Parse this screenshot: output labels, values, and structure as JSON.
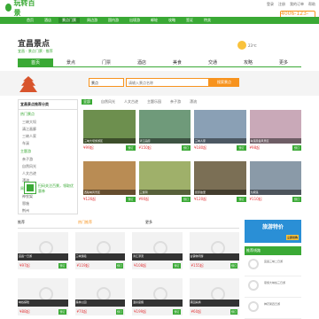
{
  "header": {
    "logo_text": "玩转百景",
    "top_links": [
      "登录",
      "注册",
      "我的订单",
      "帮助"
    ],
    "hotline": "4006-123-100"
  },
  "nav": {
    "items": [
      "首页",
      "酒店",
      "景点门票",
      "周边游",
      "国内游",
      "出境游",
      "邮轮",
      "攻略",
      "签证",
      "特卖"
    ],
    "active_index": 2
  },
  "page": {
    "title": "宜昌景点",
    "subtitle": "宜昌 · 景点门票 · 推荐",
    "weather": "23℃"
  },
  "tabs": {
    "items": [
      "首页",
      "景点",
      "门票",
      "酒店",
      "美食",
      "交通",
      "攻略",
      "更多"
    ],
    "active_index": 0
  },
  "search": {
    "select_value": "景点",
    "placeholder": "请输入景点名称",
    "button": "搜索景点"
  },
  "sidebar": {
    "title": "宜昌景点推荐分类",
    "sections": [
      {
        "name": "热门景点",
        "items": [
          "三峡大坝",
          "清江画廊",
          "三峡人家",
          "车溪"
        ]
      },
      {
        "name": "主题游",
        "items": [
          "亲子游",
          "自然风光",
          "人文古迹",
          "漂流"
        ]
      },
      {
        "name": "周边推荐",
        "items": [
          "神农架",
          "恩施",
          "荆州"
        ]
      }
    ],
    "qr_text": "扫码关注百景，领取优惠券"
  },
  "filters": {
    "items": [
      "全部",
      "自然风光",
      "人文古迹",
      "主题乐园",
      "亲子游",
      "漂流"
    ],
    "active_index": 0
  },
  "cards": [
    {
      "caption": "三峡大坝旅游区",
      "price": "¥99起",
      "btn": "预订",
      "color": "#6d8f4e"
    },
    {
      "caption": "清江画廊",
      "price": "¥150起",
      "btn": "预订",
      "color": "#6f9a7a"
    },
    {
      "caption": "三峡人家",
      "price": "¥180起",
      "btn": "预订",
      "color": "#8aa0b5"
    },
    {
      "caption": "车溪民俗风景区",
      "price": "¥98起",
      "btn": "预订",
      "color": "#c9a9b8"
    },
    {
      "caption": "西陵峡风景区",
      "price": "¥126起",
      "btn": "预订",
      "color": "#b98c54"
    },
    {
      "caption": "三游洞",
      "price": "¥90起",
      "btn": "预订",
      "color": "#9fb06a"
    },
    {
      "caption": "屈原故里",
      "price": "¥120起",
      "btn": "预订",
      "color": "#7b6f55"
    },
    {
      "caption": "九畹溪",
      "price": "¥110起",
      "btn": "预订",
      "color": "#8a9aa8"
    }
  ],
  "section2": {
    "title": "推荐",
    "hot": "热门推荐",
    "more": "更多"
  },
  "grid2": [
    {
      "caption": "宜昌一日游",
      "price": "¥97起",
      "btn": "预订"
    },
    {
      "caption": "三峡游船",
      "price": "¥119起",
      "btn": "预订"
    },
    {
      "caption": "清江漂流",
      "price": "¥108起",
      "btn": "预订"
    },
    {
      "caption": "古镇休闲游",
      "price": "¥155起",
      "btn": "预订"
    },
    {
      "caption": "峡谷探险",
      "price": "¥88起",
      "btn": "预订"
    },
    {
      "caption": "森林公园",
      "price": "¥70起",
      "btn": "预订"
    },
    {
      "caption": "温泉度假",
      "price": "¥199起",
      "btn": "预订"
    },
    {
      "caption": "茶园采摘",
      "price": "¥60起",
      "btn": "预订"
    }
  ],
  "promo": {
    "title": "旅游特价",
    "tag": "立即抢购"
  },
  "right_list": {
    "title": "推荐线路",
    "items": [
      "宜昌三峡二日游",
      "恩施大峡谷三日游",
      "神农架四日游"
    ]
  }
}
